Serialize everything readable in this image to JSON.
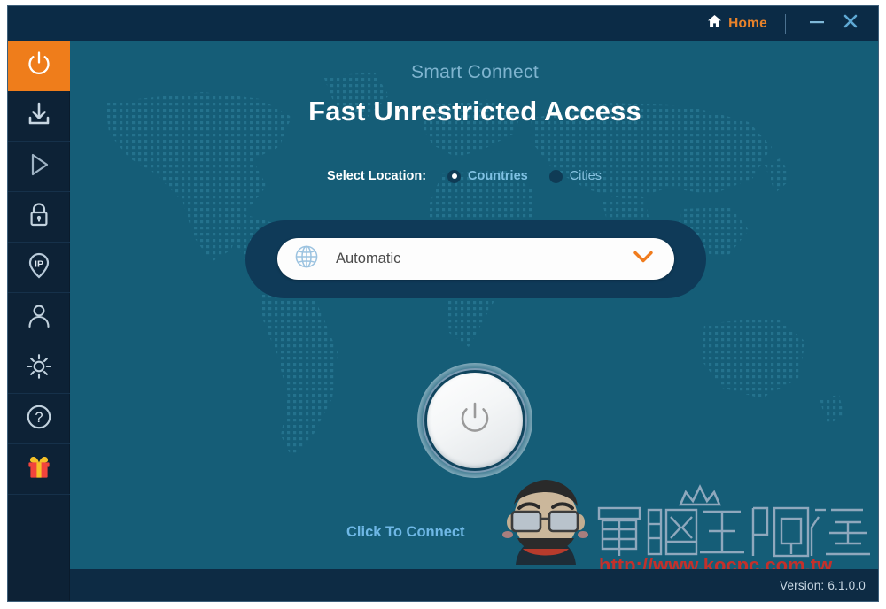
{
  "window": {
    "title_bar": {
      "home_label": "Home",
      "home_icon": "home-icon",
      "minimize_icon": "minimize-icon",
      "close_icon": "close-icon"
    },
    "frame_colors": {
      "title_bar_bg": "#0b2b46",
      "sidebar_bg": "#0d2236",
      "content_bg": "#155d77",
      "footer_bg": "#0d2b44",
      "accent_orange": "#ef7d1b",
      "light_blue": "#7fb4cf"
    }
  },
  "sidebar": {
    "items": [
      {
        "name": "power",
        "icon": "power-icon",
        "active": true
      },
      {
        "name": "download",
        "icon": "download-icon",
        "active": false
      },
      {
        "name": "play",
        "icon": "play-icon",
        "active": false
      },
      {
        "name": "lock",
        "icon": "lock-icon",
        "active": false
      },
      {
        "name": "ip",
        "icon": "ip-pin-icon",
        "active": false
      },
      {
        "name": "account",
        "icon": "user-icon",
        "active": false
      },
      {
        "name": "settings",
        "icon": "gear-icon",
        "active": false
      },
      {
        "name": "help",
        "icon": "question-icon",
        "active": false
      },
      {
        "name": "gift",
        "icon": "gift-icon",
        "active": false
      }
    ]
  },
  "main": {
    "subtitle": "Smart Connect",
    "headline": "Fast Unrestricted Access",
    "location": {
      "label": "Select Location:",
      "options": [
        {
          "label": "Countries",
          "selected": true
        },
        {
          "label": "Cities",
          "selected": false
        }
      ]
    },
    "server_dropdown": {
      "value": "Automatic",
      "globe_icon": "globe-icon",
      "chevron_icon": "chevron-down-icon",
      "chevron_color": "#f07c1e"
    },
    "connect_button": {
      "icon": "power-icon",
      "caption": "Click To Connect"
    }
  },
  "watermark": {
    "chinese_text": "電腦王阿達",
    "url": "http://www.kocpc.com.tw",
    "url_color": "#c4302b",
    "face_icon": "cartoon-face-icon",
    "crown_icon": "crown-icon"
  },
  "footer": {
    "version_text": "Version: 6.1.0.0"
  }
}
